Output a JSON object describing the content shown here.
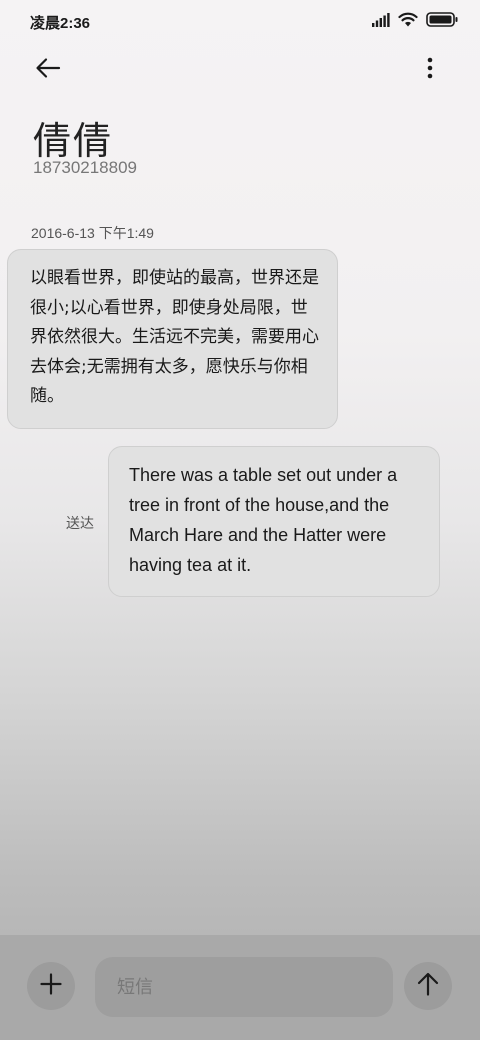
{
  "status_bar": {
    "time": "凌晨2:36",
    "icons": [
      "signal-icon",
      "wifi-icon",
      "battery-icon"
    ]
  },
  "app_bar": {
    "back_icon": "arrow-left-icon",
    "more_icon": "more-vertical-icon"
  },
  "contact": {
    "name": "倩倩",
    "number": "18730218809"
  },
  "conversation": {
    "timestamp": "2016-6-13 下午1:49",
    "messages": [
      {
        "direction": "incoming",
        "text": "以眼看世界，即使站的最高，世界还是很小;以心看世界，即使身处局限，世界依然很大。生活远不完美，需要用心去体会;无需拥有太多，愿快乐与你相随。"
      },
      {
        "direction": "outgoing",
        "text": "There was a table set out under a tree in front of the house,and the March Hare and the Hatter were having tea at it.",
        "status": "送达"
      }
    ]
  },
  "compose": {
    "add_icon": "plus-icon",
    "placeholder": "短信",
    "value": "",
    "send_icon": "arrow-up-icon"
  },
  "colors": {
    "bubble": "#e1e1e1",
    "compose_bar": "#a9a9a9"
  }
}
